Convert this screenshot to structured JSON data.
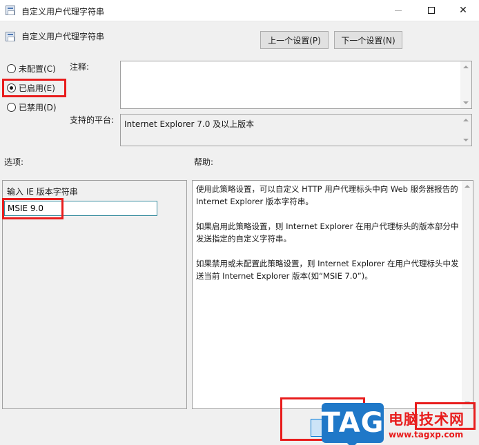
{
  "window": {
    "title": "自定义用户代理字符串",
    "minimize_icon": "minimize-icon",
    "maximize_icon": "maximize-icon",
    "close_icon": "close-icon",
    "close_glyph": "✕"
  },
  "header": {
    "policy_name": "自定义用户代理字符串",
    "prev_button": "上一个设置(P)",
    "next_button": "下一个设置(N)"
  },
  "state": {
    "options": [
      {
        "label": "未配置(C)",
        "checked": false
      },
      {
        "label": "已启用(E)",
        "checked": true
      },
      {
        "label": "已禁用(D)",
        "checked": false
      }
    ]
  },
  "comment": {
    "label": "注释:",
    "value": ""
  },
  "platform": {
    "label": "支持的平台:",
    "value": "Internet Explorer 7.0 及以上版本"
  },
  "options_section": {
    "label": "选项:",
    "field_label": "输入 IE 版本字符串",
    "field_value": "MSIE 9.0"
  },
  "help_section": {
    "label": "帮助:",
    "paragraphs": [
      "使用此策略设置，可以自定义 HTTP 用户代理标头中向 Web 服务器报告的 Internet Explorer 版本字符串。",
      "如果启用此策略设置，则 Internet Explorer 在用户代理标头的版本部分中发送指定的自定义字符串。",
      "如果禁用或未配置此策略设置，则 Internet Explorer 在用户代理标头中发送当前 Internet Explorer 版本(如“MSIE 7.0”)。"
    ]
  },
  "watermark": {
    "logo_text": "TAG",
    "site_name": "电脑技术网",
    "url": "www.tagxp.com"
  },
  "colors": {
    "highlight_red": "#e81c1c",
    "tag_blue": "#1f78c8"
  }
}
